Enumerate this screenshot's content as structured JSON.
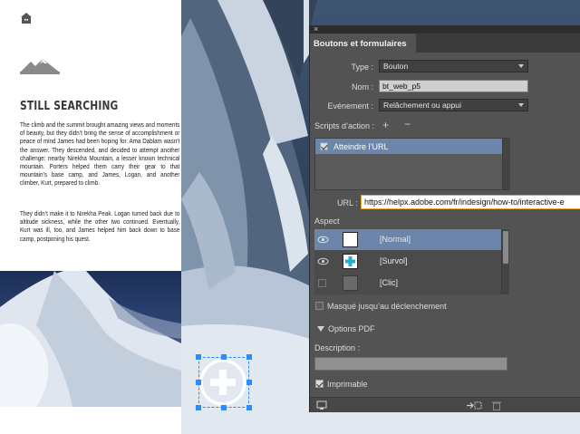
{
  "page": {
    "title": "STILL SEARCHING",
    "paragraph1": "The climb and the summit brought amazing views and moments of beauty, but they didn’t bring the sense of accomplishment or peace of mind James had been hoping for. Ama Dablam wasn’t the answer. They descended, and decided to attempt another challenge: nearby Nirekha Mountain, a lesser known technical mountain. Porters helped them carry their gear to that mountain’s base camp, and James, Logan, and another climber, Kurt, prepared to climb.",
    "paragraph2": "They didn’t make it to Nirekha Peak. Logan turned back due to altitude sickness, while the other two continued. Eventually, Kurt was ill, too, and James helped him back down to base camp, postponing his quest.",
    "icons": [
      "home-icon",
      "mountain-logo-icon"
    ]
  },
  "panel": {
    "close_glyph": "×",
    "tab_label": "Boutons et formulaires",
    "type_label": "Type :",
    "type_value": "Bouton",
    "name_label": "Nom :",
    "name_value": "bt_web_p5",
    "event_label": "Evénement :",
    "event_value": "Relâchement ou appui",
    "actions_label": "Scripts d’action :",
    "add_action_glyph": "+",
    "remove_action_glyph": "−",
    "actions": [
      {
        "label": "Atteindre l’URL",
        "checked": true
      }
    ],
    "url_label": "URL :",
    "url_value": "https://helpx.adobe.com/fr/indesign/how-to/interactive-e",
    "aspect_label": "Aspect",
    "appearances": [
      {
        "label": "[Normal]",
        "selected": true
      },
      {
        "label": "[Survol]",
        "selected": false
      },
      {
        "label": "[Clic]",
        "selected": false
      }
    ],
    "hidden_until_label": "Masqué jusqu’au déclenchement",
    "pdf_options_label": "Options PDF",
    "description_label": "Description :",
    "description_value": "",
    "printable_label": "Imprimable",
    "printable_checked": true,
    "footer_icons": [
      "preview-spread-icon",
      "convert-to-object-icon",
      "delete-icon"
    ]
  },
  "colors": {
    "panel_bg": "#535353",
    "selection_blue": "#6b86aa",
    "frame_blue": "#2e8bff",
    "url_focus": "#e5a53a",
    "survol_plus": "#1fb0d4"
  }
}
